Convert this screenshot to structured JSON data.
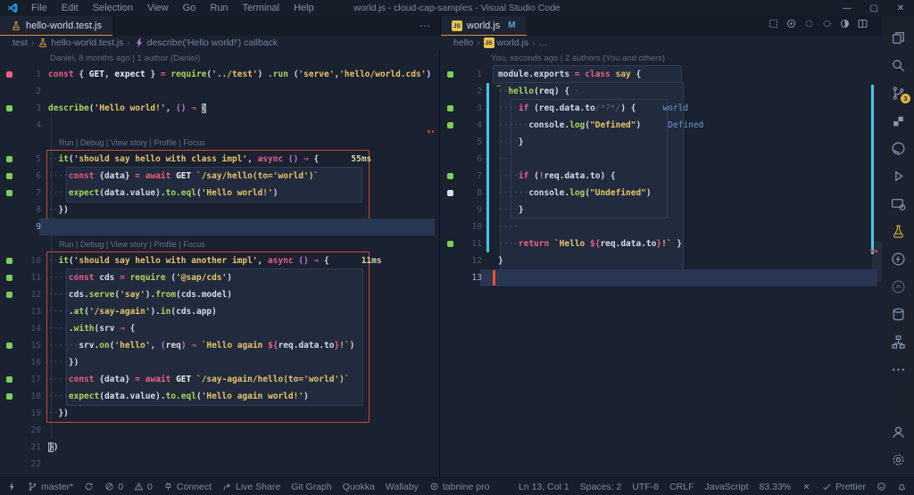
{
  "title_bar": {
    "menus": [
      "File",
      "Edit",
      "Selection",
      "View",
      "Go",
      "Run",
      "Terminal",
      "Help"
    ],
    "title": "world.js - cloud-cap-samples - Visual Studio Code",
    "window_controls": [
      "—",
      "▢",
      "✕"
    ]
  },
  "colors": {
    "accent_tab_underline": "#d79044",
    "cursor": "#f2502c",
    "test_boundary": "#c64e26",
    "git_modified": "#45c6e8",
    "marker_green": "#7ccf5a",
    "marker_pink": "#f25d84",
    "scm_badge": "#e3b341"
  },
  "left_group": {
    "tab": {
      "label": "hello-world.test.js",
      "icon": "beaker"
    },
    "overflow": "⋯",
    "breadcrumb": [
      {
        "label": "test"
      },
      {
        "label": "hello-world.test.js",
        "icon": "beaker"
      },
      {
        "label": "describe('Hello world!') callback",
        "icon": "symbol-event"
      }
    ],
    "rows": [
      {
        "t": "blame",
        "text": "Daniel, 8 months ago | 1 author (Daniel)"
      },
      {
        "t": "c",
        "n": 1,
        "m": "p",
        "tk": [
          [
            "const ",
            "k"
          ],
          [
            "{ ",
            "w"
          ],
          [
            "GET",
            "b"
          ],
          [
            ", ",
            "w"
          ],
          [
            "expect",
            "b"
          ],
          [
            " } ",
            "w"
          ],
          [
            "= ",
            "k"
          ],
          [
            "require",
            "g"
          ],
          [
            "(",
            "w"
          ],
          [
            "'../test'",
            "y"
          ],
          [
            ") ",
            "w"
          ],
          [
            ".run",
            "g"
          ],
          [
            " (",
            "w"
          ],
          [
            "'serve'",
            "y"
          ],
          [
            ",",
            "w"
          ],
          [
            "'hello/world.cds'",
            "y"
          ],
          [
            ")",
            "w"
          ]
        ]
      },
      {
        "t": "c",
        "n": 2,
        "tk": []
      },
      {
        "t": "c",
        "n": 3,
        "m": "g",
        "tk": [
          [
            "describe",
            "g"
          ],
          [
            "(",
            "w"
          ],
          [
            "'Hello world!'",
            "y"
          ],
          [
            ", ",
            "w"
          ],
          [
            "()",
            "p"
          ],
          [
            " ",
            "w"
          ],
          [
            "⇒",
            "k"
          ],
          [
            " ",
            "w"
          ],
          [
            "{",
            "bm"
          ]
        ]
      },
      {
        "t": "c",
        "n": 4,
        "tk": []
      },
      {
        "t": "lens",
        "text": "Run | Debug | View story | Profile | Focus"
      },
      {
        "t": "c",
        "n": 5,
        "m": "g",
        "tk": [
          [
            "··",
            "ws"
          ],
          [
            "it",
            "g"
          ],
          [
            "(",
            "w"
          ],
          [
            "'should say hello with class impl'",
            "y"
          ],
          [
            ", ",
            "w"
          ],
          [
            "async ",
            "k"
          ],
          [
            "()",
            "p"
          ],
          [
            " ",
            "w"
          ],
          [
            "⇒",
            "k"
          ],
          [
            " {",
            "w"
          ],
          [
            "55ms",
            "ms"
          ]
        ]
      },
      {
        "t": "c",
        "n": 6,
        "m": "g",
        "tk": [
          [
            "····",
            "ws"
          ],
          [
            "const ",
            "k"
          ],
          [
            "{",
            "w"
          ],
          [
            "data",
            "w"
          ],
          [
            "} ",
            "w"
          ],
          [
            "= ",
            "k"
          ],
          [
            "await ",
            "k"
          ],
          [
            "GET",
            "b"
          ],
          [
            " ",
            "w"
          ],
          [
            "`/say/hello(to='world')`",
            "y"
          ]
        ]
      },
      {
        "t": "c",
        "n": 7,
        "m": "g",
        "tk": [
          [
            "····",
            "ws"
          ],
          [
            "expect",
            "g"
          ],
          [
            "(",
            "w"
          ],
          [
            "data.value",
            "w"
          ],
          [
            ").",
            "w"
          ],
          [
            "to.eql",
            "g"
          ],
          [
            "(",
            "w"
          ],
          [
            "'Hello world!'",
            "y"
          ],
          [
            ")",
            "w"
          ]
        ]
      },
      {
        "t": "c",
        "n": 8,
        "tk": [
          [
            "··",
            "ws"
          ],
          [
            "})",
            "w"
          ]
        ]
      },
      {
        "t": "c",
        "n": 9,
        "hl": true,
        "tk": []
      },
      {
        "t": "lens",
        "text": "Run | Debug | View story | Profile | Focus"
      },
      {
        "t": "c",
        "n": 10,
        "m": "g",
        "tk": [
          [
            "··",
            "ws"
          ],
          [
            "it",
            "g"
          ],
          [
            "(",
            "w"
          ],
          [
            "'should say hello with another impl'",
            "y"
          ],
          [
            ", ",
            "w"
          ],
          [
            "async ",
            "k"
          ],
          [
            "()",
            "p"
          ],
          [
            " ",
            "w"
          ],
          [
            "⇒",
            "k"
          ],
          [
            " {",
            "w"
          ],
          [
            "11ms",
            "ms"
          ]
        ]
      },
      {
        "t": "c",
        "n": 11,
        "m": "g",
        "tk": [
          [
            "····",
            "ws"
          ],
          [
            "const ",
            "k"
          ],
          [
            "cds ",
            "w"
          ],
          [
            "= ",
            "k"
          ],
          [
            "require",
            "g"
          ],
          [
            " (",
            "w"
          ],
          [
            "'@sap/cds'",
            "y"
          ],
          [
            ")",
            "w"
          ]
        ]
      },
      {
        "t": "c",
        "n": 12,
        "m": "g",
        "tk": [
          [
            "····",
            "ws"
          ],
          [
            "cds.",
            "w"
          ],
          [
            "serve",
            "g"
          ],
          [
            "(",
            "w"
          ],
          [
            "'say'",
            "y"
          ],
          [
            ").",
            "w"
          ],
          [
            "from",
            "g"
          ],
          [
            "(",
            "w"
          ],
          [
            "cds.model",
            "w"
          ],
          [
            ")",
            "w"
          ]
        ]
      },
      {
        "t": "c",
        "n": 13,
        "tk": [
          [
            "····",
            "ws"
          ],
          [
            ".",
            "w"
          ],
          [
            "at",
            "g"
          ],
          [
            "(",
            "w"
          ],
          [
            "'/say-again'",
            "y"
          ],
          [
            ").",
            "w"
          ],
          [
            "in",
            "g"
          ],
          [
            "(",
            "w"
          ],
          [
            "cds.app",
            "w"
          ],
          [
            ")",
            "w"
          ]
        ]
      },
      {
        "t": "c",
        "n": 14,
        "tk": [
          [
            "····",
            "ws"
          ],
          [
            ".",
            "w"
          ],
          [
            "with",
            "g"
          ],
          [
            "(",
            "w"
          ],
          [
            "srv ",
            "w"
          ],
          [
            "⇒",
            "k"
          ],
          [
            " {",
            "w"
          ]
        ]
      },
      {
        "t": "c",
        "n": 15,
        "m": "g",
        "tk": [
          [
            "······",
            "ws"
          ],
          [
            "srv.",
            "w"
          ],
          [
            "on",
            "g"
          ],
          [
            "(",
            "w"
          ],
          [
            "'hello'",
            "y"
          ],
          [
            ", ",
            "w"
          ],
          [
            "(",
            "p"
          ],
          [
            "req",
            "w"
          ],
          [
            ")",
            "p"
          ],
          [
            " ",
            "w"
          ],
          [
            "⇒",
            "k"
          ],
          [
            " ",
            "w"
          ],
          [
            "`Hello again ",
            "y"
          ],
          [
            "${",
            "k"
          ],
          [
            "req.data.to",
            "w"
          ],
          [
            "}",
            "k"
          ],
          [
            "!`",
            "y"
          ],
          [
            ")",
            "w"
          ]
        ]
      },
      {
        "t": "c",
        "n": 16,
        "tk": [
          [
            "····",
            "ws"
          ],
          [
            "})",
            "w"
          ]
        ]
      },
      {
        "t": "c",
        "n": 17,
        "m": "g",
        "tk": [
          [
            "····",
            "ws"
          ],
          [
            "const ",
            "k"
          ],
          [
            "{",
            "w"
          ],
          [
            "data",
            "w"
          ],
          [
            "} ",
            "w"
          ],
          [
            "= ",
            "k"
          ],
          [
            "await ",
            "k"
          ],
          [
            "GET",
            "b"
          ],
          [
            " ",
            "w"
          ],
          [
            "`/say-again/hello(to='world')`",
            "y"
          ]
        ]
      },
      {
        "t": "c",
        "n": 18,
        "m": "g",
        "tk": [
          [
            "····",
            "ws"
          ],
          [
            "expect",
            "g"
          ],
          [
            "(",
            "w"
          ],
          [
            "data.value",
            "w"
          ],
          [
            ").",
            "w"
          ],
          [
            "to.eql",
            "g"
          ],
          [
            "(",
            "w"
          ],
          [
            "'Hello again world!'",
            "y"
          ],
          [
            ")",
            "w"
          ]
        ]
      },
      {
        "t": "c",
        "n": 19,
        "tk": [
          [
            "··",
            "ws"
          ],
          [
            "})",
            "w"
          ]
        ]
      },
      {
        "t": "c",
        "n": 20,
        "tk": []
      },
      {
        "t": "c",
        "n": 21,
        "tk": [
          [
            "}",
            "bm"
          ],
          [
            ")",
            "w"
          ]
        ]
      },
      {
        "t": "c",
        "n": 22,
        "tk": []
      }
    ]
  },
  "right_group": {
    "tab": {
      "label": "world.js",
      "icon": "js",
      "badge": "M"
    },
    "breadcrumb": [
      {
        "label": "hello"
      },
      {
        "label": "world.js",
        "icon": "js"
      },
      {
        "label": "…"
      }
    ],
    "editor_actions": [
      "test-run",
      "run-circle",
      "circle-outline",
      "circle-outline-2",
      "pie-circle",
      "split-editor",
      "more-actions"
    ],
    "inline_hint": "…",
    "rows": [
      {
        "t": "blame",
        "text": "You, seconds ago | 2 authors (You and others)"
      },
      {
        "t": "c",
        "n": 1,
        "m": "g",
        "tk": [
          [
            "module.exports ",
            "w"
          ],
          [
            "= ",
            "k"
          ],
          [
            "class ",
            "k"
          ],
          [
            "say ",
            "y"
          ],
          [
            "{",
            "w"
          ]
        ]
      },
      {
        "t": "c",
        "n": 2,
        "tk": [
          [
            "··",
            "ws"
          ],
          [
            "hello",
            "g"
          ],
          [
            "(",
            "w"
          ],
          [
            "req",
            "w"
          ],
          [
            ") {",
            "w"
          ],
          [
            " ·",
            "ws"
          ]
        ]
      },
      {
        "t": "c",
        "n": 3,
        "m": "g",
        "tk": [
          [
            "····",
            "ws"
          ],
          [
            "if ",
            "k"
          ],
          [
            "(",
            "w"
          ],
          [
            "req.data.to",
            "w"
          ],
          [
            "/*?*/",
            "cm"
          ],
          [
            ") {",
            "w"
          ],
          [
            "world",
            "iv"
          ]
        ]
      },
      {
        "t": "c",
        "n": 4,
        "m": "g",
        "tk": [
          [
            "······",
            "ws"
          ],
          [
            "console.",
            "w"
          ],
          [
            "log",
            "g"
          ],
          [
            "(",
            "w"
          ],
          [
            "\"Defined\"",
            "y"
          ],
          [
            ")",
            "w"
          ],
          [
            "Defined",
            "iv"
          ]
        ]
      },
      {
        "t": "c",
        "n": 5,
        "tk": [
          [
            "····",
            "ws"
          ],
          [
            "}",
            "w"
          ]
        ]
      },
      {
        "t": "c",
        "n": 6,
        "tk": [
          [
            "··",
            "ws"
          ]
        ]
      },
      {
        "t": "c",
        "n": 7,
        "m": "g",
        "tk": [
          [
            "····",
            "ws"
          ],
          [
            "if ",
            "k"
          ],
          [
            "(",
            "w"
          ],
          [
            "!",
            "k"
          ],
          [
            "req.data.to",
            "w"
          ],
          [
            ") {",
            "w"
          ]
        ]
      },
      {
        "t": "c",
        "n": 8,
        "m": "w",
        "tk": [
          [
            "······",
            "ws"
          ],
          [
            "console.",
            "w"
          ],
          [
            "log",
            "g"
          ],
          [
            "(",
            "w"
          ],
          [
            "\"Undefined\"",
            "y"
          ],
          [
            ")",
            "w"
          ]
        ]
      },
      {
        "t": "c",
        "n": 9,
        "tk": [
          [
            "····",
            "ws"
          ],
          [
            "}",
            "w"
          ]
        ]
      },
      {
        "t": "c",
        "n": 10,
        "tk": [
          [
            "····",
            "ws"
          ]
        ]
      },
      {
        "t": "c",
        "n": 11,
        "m": "g",
        "tk": [
          [
            "····",
            "ws"
          ],
          [
            "return ",
            "k"
          ],
          [
            "`Hello ",
            "y"
          ],
          [
            "${",
            "k"
          ],
          [
            "req.data.to",
            "w"
          ],
          [
            "}",
            "k"
          ],
          [
            "!`",
            "y"
          ],
          [
            " }",
            "w"
          ]
        ]
      },
      {
        "t": "c",
        "n": 12,
        "tk": [
          [
            "}",
            "w"
          ]
        ]
      },
      {
        "t": "c",
        "n": 13,
        "hl": true,
        "cursor": true,
        "tk": []
      }
    ]
  },
  "activity_bar": {
    "top": [
      {
        "name": "explorer",
        "icon": "files"
      },
      {
        "name": "search",
        "icon": "search"
      },
      {
        "name": "source-control",
        "icon": "branch",
        "badge": "3"
      },
      {
        "name": "blocks",
        "icon": "blocks"
      },
      {
        "name": "github",
        "icon": "github"
      },
      {
        "name": "run-debug",
        "icon": "run"
      },
      {
        "name": "remote-explorer",
        "icon": "remote-window"
      },
      {
        "name": "testing",
        "icon": "beaker"
      },
      {
        "name": "thunder-client",
        "icon": "thunder"
      },
      {
        "name": "circle-caret",
        "icon": "circle-caret",
        "dim": true
      },
      {
        "name": "database",
        "icon": "database"
      },
      {
        "name": "sitemap",
        "icon": "sitemap"
      },
      {
        "name": "more-views",
        "icon": "more"
      }
    ],
    "bottom": [
      {
        "name": "account",
        "icon": "account"
      },
      {
        "name": "settings",
        "icon": "gear"
      }
    ]
  },
  "status_bar": {
    "left": [
      {
        "name": "remote",
        "icon": "bolt"
      },
      {
        "name": "git-branch",
        "icon": "branch",
        "label": "master*"
      },
      {
        "name": "sync",
        "icon": "sync"
      },
      {
        "name": "errors",
        "icon": "error",
        "label": "0"
      },
      {
        "name": "warnings",
        "icon": "warning",
        "label": "0"
      },
      {
        "name": "connect",
        "icon": "plug",
        "label": "Connect"
      },
      {
        "name": "live-share",
        "icon": "share",
        "label": "Live Share"
      },
      {
        "name": "git-graph",
        "label": "Git Graph"
      },
      {
        "name": "quokka",
        "label": "Quokka"
      },
      {
        "name": "wallaby",
        "label": "Wallaby"
      },
      {
        "name": "tabnine",
        "icon": "tabnine",
        "label": "tabnine pro"
      }
    ],
    "right": [
      {
        "name": "cursor-position",
        "label": "Ln 13, Col 1"
      },
      {
        "name": "indentation",
        "label": "Spaces: 2"
      },
      {
        "name": "encoding",
        "label": "UTF-8"
      },
      {
        "name": "eol",
        "label": "CRLF"
      },
      {
        "name": "language-mode",
        "label": "JavaScript"
      },
      {
        "name": "coverage",
        "label": "83.33%"
      },
      {
        "name": "x-indicator",
        "icon": "x-mark"
      },
      {
        "name": "prettier",
        "icon": "check",
        "label": "Prettier"
      },
      {
        "name": "feedback",
        "icon": "feedback"
      },
      {
        "name": "notifications",
        "icon": "bell"
      }
    ]
  }
}
